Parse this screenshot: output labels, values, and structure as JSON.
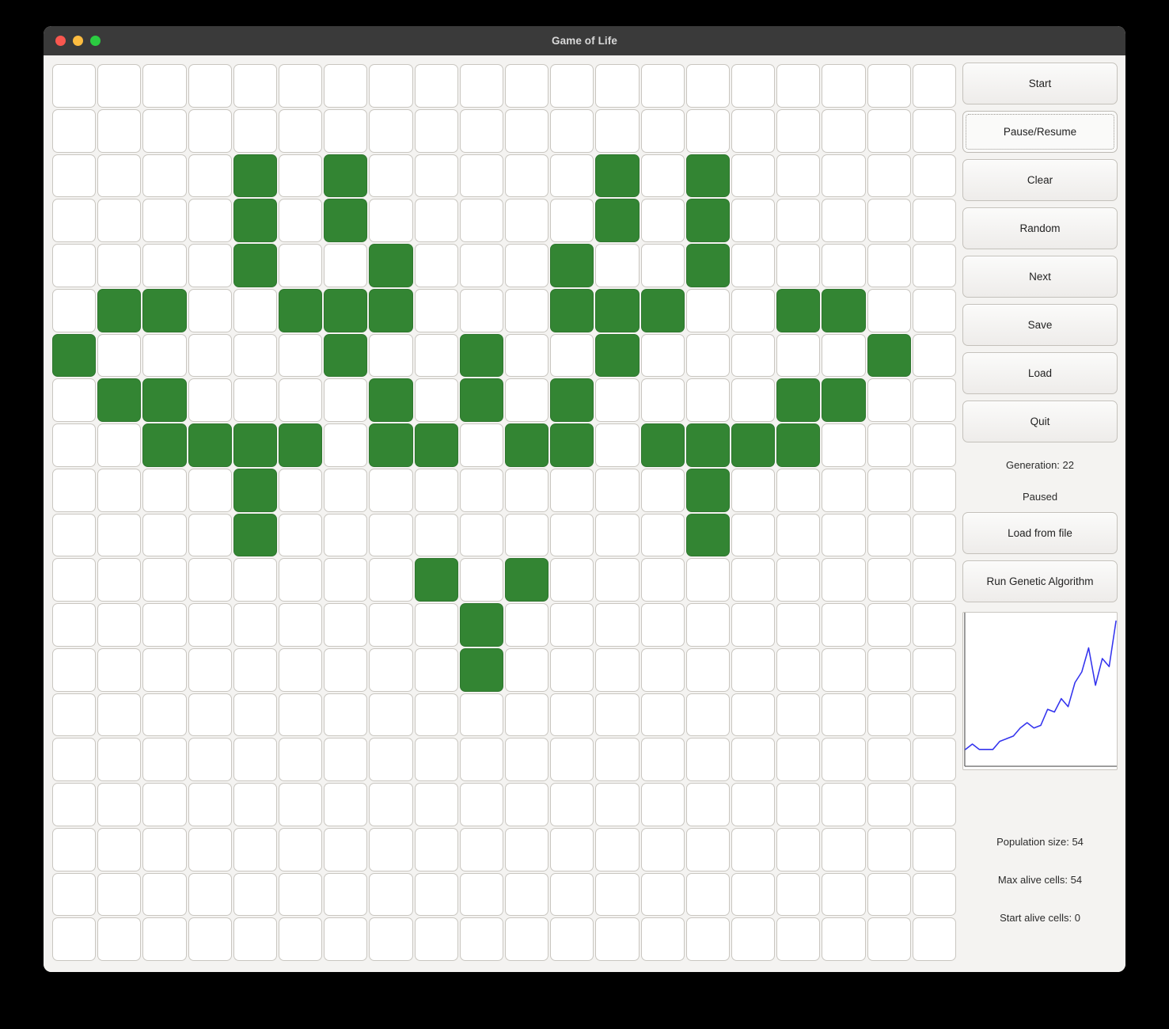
{
  "window": {
    "title": "Game of Life",
    "controls": [
      "close",
      "minimize",
      "zoom"
    ]
  },
  "grid": {
    "rows": 20,
    "cols": 20,
    "alive_color": "#338533",
    "dead_color": "#ffffff",
    "alive_cells": [
      [
        2,
        4
      ],
      [
        2,
        6
      ],
      [
        2,
        12
      ],
      [
        2,
        14
      ],
      [
        3,
        4
      ],
      [
        3,
        6
      ],
      [
        3,
        12
      ],
      [
        3,
        14
      ],
      [
        4,
        4
      ],
      [
        4,
        7
      ],
      [
        4,
        11
      ],
      [
        4,
        14
      ],
      [
        5,
        1
      ],
      [
        5,
        2
      ],
      [
        5,
        5
      ],
      [
        5,
        6
      ],
      [
        5,
        7
      ],
      [
        5,
        11
      ],
      [
        5,
        12
      ],
      [
        5,
        13
      ],
      [
        5,
        16
      ],
      [
        5,
        17
      ],
      [
        6,
        0
      ],
      [
        6,
        6
      ],
      [
        6,
        9
      ],
      [
        6,
        12
      ],
      [
        6,
        18
      ],
      [
        7,
        1
      ],
      [
        7,
        2
      ],
      [
        7,
        7
      ],
      [
        7,
        9
      ],
      [
        7,
        11
      ],
      [
        7,
        16
      ],
      [
        7,
        17
      ],
      [
        8,
        2
      ],
      [
        8,
        3
      ],
      [
        8,
        4
      ],
      [
        8,
        5
      ],
      [
        8,
        7
      ],
      [
        8,
        8
      ],
      [
        8,
        10
      ],
      [
        8,
        11
      ],
      [
        8,
        13
      ],
      [
        8,
        14
      ],
      [
        8,
        15
      ],
      [
        8,
        16
      ],
      [
        9,
        4
      ],
      [
        9,
        14
      ],
      [
        10,
        4
      ],
      [
        10,
        14
      ],
      [
        11,
        8
      ],
      [
        11,
        10
      ],
      [
        12,
        9
      ],
      [
        13,
        9
      ]
    ]
  },
  "controls": {
    "buttons": [
      {
        "label": "Start",
        "name": "start-button",
        "focused": false
      },
      {
        "label": "Pause/Resume",
        "name": "pause-resume-button",
        "focused": true
      },
      {
        "label": "Clear",
        "name": "clear-button",
        "focused": false
      },
      {
        "label": "Random",
        "name": "random-button",
        "focused": false
      },
      {
        "label": "Next",
        "name": "next-button",
        "focused": false
      },
      {
        "label": "Save",
        "name": "save-button",
        "focused": false
      },
      {
        "label": "Load",
        "name": "load-button",
        "focused": false
      },
      {
        "label": "Quit",
        "name": "quit-button",
        "focused": false
      }
    ],
    "generation_label": "Generation: 22",
    "run_state_label": "Paused",
    "load_from_file_label": "Load from file",
    "run_genetic_algorithm_label": "Run Genetic Algorithm"
  },
  "stats": {
    "population_size": "Population size: 54",
    "max_alive_cells": "Max alive cells: 54",
    "start_alive_cells": "Start alive cells: 0"
  },
  "chart_data": {
    "type": "line",
    "title": "",
    "xlabel": "",
    "ylabel": "",
    "series_color": "#3333ee",
    "x": [
      0,
      1,
      2,
      3,
      4,
      5,
      6,
      7,
      8,
      9,
      10,
      11,
      12,
      13,
      14,
      15,
      16,
      17,
      18,
      19,
      20,
      21,
      22
    ],
    "values": [
      6,
      8,
      6,
      6,
      6,
      9,
      10,
      11,
      14,
      16,
      14,
      15,
      21,
      20,
      25,
      22,
      31,
      35,
      44,
      30,
      40,
      37,
      54
    ],
    "xlim": [
      0,
      22
    ],
    "ylim": [
      0,
      56
    ],
    "grid": false,
    "legend": "none"
  }
}
